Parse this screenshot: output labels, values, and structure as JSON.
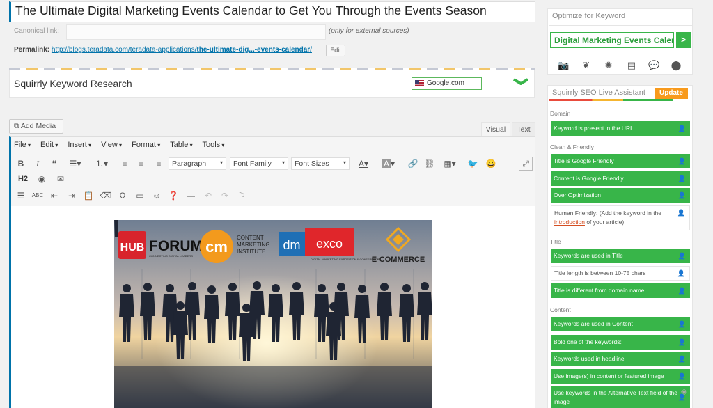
{
  "post": {
    "title": "The Ultimate Digital Marketing Events Calendar to Get You Through the Events Season",
    "canonical_label": "Canonical link:",
    "canonical_note": "(only for external sources)",
    "permalink_label": "Permalink:",
    "permalink_base": "http://blogs.teradata.com/teradata-applications/",
    "permalink_slug": "the-ultimate-dig...-events-calendar/",
    "edit_label": "Edit"
  },
  "keyword_research": {
    "title": "Squirrly Keyword Research",
    "country": "Google.com"
  },
  "editor": {
    "add_media_label": "Add Media",
    "tab_visual": "Visual",
    "tab_text": "Text",
    "menus": [
      "File",
      "Edit",
      "Insert",
      "View",
      "Format",
      "Table",
      "Tools"
    ],
    "paragraph_select": "Paragraph",
    "font_family_select": "Font Family",
    "font_size_select": "Font Sizes",
    "h2_label": "H2"
  },
  "hero_image": {
    "logos": [
      "HUB",
      "FORUM",
      "CONNECTING DIGITAL LEADERS",
      "cm",
      "CONTENT",
      "MARKETING",
      "INSTITUTE",
      "dm",
      "exco",
      "DIGITAL MARKETING EXPOSITION & CONFERENCE",
      "E-COMMERCE"
    ]
  },
  "sidebar": {
    "optimize_title": "Optimize for Keyword",
    "keyword_value": "Digital Marketing Events Calen",
    "go_label": ">",
    "icons": [
      "camera-icon",
      "twitter-icon",
      "settings-icon",
      "news-icon",
      "chat-icon",
      "location-icon"
    ],
    "live_assistant_title": "Squirrly SEO Live Assistant",
    "update_label": "Update",
    "sections": {
      "domain": "Domain",
      "clean": "Clean & Friendly",
      "title": "Title",
      "content": "Content"
    },
    "rules": {
      "domain": [
        {
          "text": "Keyword is present in the URL",
          "done": true
        }
      ],
      "clean": [
        {
          "text": "Title is Google Friendly",
          "done": true
        },
        {
          "text": "Content is Google Friendly",
          "done": true
        },
        {
          "text": "Over Optimization",
          "done": true
        }
      ],
      "human_friendly": {
        "pre": "Human Friendly: (Add the keyword in the",
        "link": "introduction",
        "post": "of your article)",
        "done": false
      },
      "title": [
        {
          "text": "Keywords are used in Title",
          "done": true
        },
        {
          "text": "Title length is between 10-75 chars",
          "done": false
        },
        {
          "text": "Title is different from domain name",
          "done": true
        }
      ],
      "content": [
        {
          "text": "Keywords are used in Content",
          "done": true
        },
        {
          "text": "Bold one of the keywords:",
          "done": true
        },
        {
          "text": "Keywords used in headline",
          "done": true
        },
        {
          "text": "Use image(s) in content or featured image",
          "done": true
        },
        {
          "text": "Use keywords in the Alternative Text field of the image",
          "done": true
        }
      ]
    }
  },
  "colors": {
    "green": "#38b549",
    "orange": "#f89a1c",
    "wp_blue": "#0073aa"
  }
}
